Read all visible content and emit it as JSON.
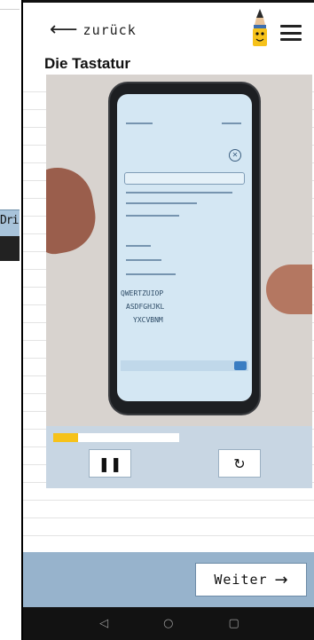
{
  "background": {
    "partial_text": "Dri"
  },
  "header": {
    "back_label": "zurück",
    "back_icon": "arrow-left-icon",
    "mascot_icon": "pencil-mascot-icon",
    "menu_icon": "hamburger-menu-icon"
  },
  "page": {
    "title": "Die Tastatur"
  },
  "video": {
    "keyboard_rows": [
      "QWERTZUIOP",
      "ASDFGHJKL",
      "YXCVBNM"
    ],
    "progress": 0.2
  },
  "controls": {
    "pause_glyph": "❚❚",
    "pause_icon": "pause-icon",
    "replay_glyph": "↻",
    "replay_icon": "replay-icon"
  },
  "footer": {
    "next_label": "Weiter",
    "next_arrow": "→"
  },
  "android_nav": {
    "back": "◁",
    "home": "○",
    "recents": "▢"
  },
  "colors": {
    "accent_progress": "#f6c21a",
    "panel": "#c8d6e3",
    "bottom_bar": "#97b3cc"
  }
}
